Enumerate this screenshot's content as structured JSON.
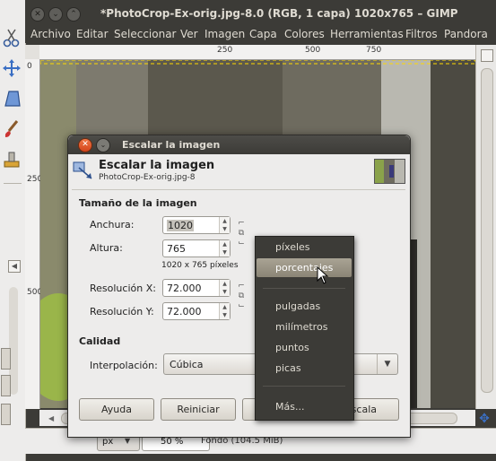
{
  "window": {
    "title": "*PhotoCrop-Ex-orig.jpg-8.0 (RGB, 1 capa) 1020x765 – GIMP"
  },
  "menubar": [
    "Archivo",
    "Editar",
    "Seleccionar",
    "Ver",
    "Imagen",
    "Capa",
    "Colores",
    "Herramientas",
    "Filtros",
    "Pandora"
  ],
  "ruler": {
    "h_labels": [
      "250",
      "500",
      "750"
    ],
    "v_labels": [
      "0",
      "250",
      "500"
    ]
  },
  "statusbar": {
    "unit": "px",
    "zoom": "50 %",
    "info": "Fondo (104.5 MiB)"
  },
  "dialog": {
    "title": "Escalar la imagen",
    "header_title": "Escalar la imagen",
    "header_subtitle": "PhotoCrop-Ex-orig.jpg-8",
    "section_size": "Tamaño de la imagen",
    "width_label": "Anchura:",
    "width_value": "1020",
    "height_label": "Altura:",
    "height_value": "765",
    "size_info": "1020 x 765 píxeles",
    "res_x_label": "Resolución X:",
    "res_x_value": "72.000",
    "res_y_label": "Resolución Y:",
    "res_y_value": "72.000",
    "section_quality": "Calidad",
    "interp_label": "Interpolación:",
    "interp_value": "Cúbica",
    "buttons": {
      "help": "Ayuda",
      "reset": "Reiniciar",
      "scale": "Escala"
    }
  },
  "unit_menu": {
    "items": [
      "píxeles",
      "porcentajes",
      "pulgadas",
      "milímetros",
      "puntos",
      "picas",
      "Más..."
    ],
    "highlighted": "porcentajes"
  },
  "colors": {
    "menu_bg": "#3c3b37",
    "highlight": "#9a9485",
    "close_btn": "#e35a2b"
  }
}
